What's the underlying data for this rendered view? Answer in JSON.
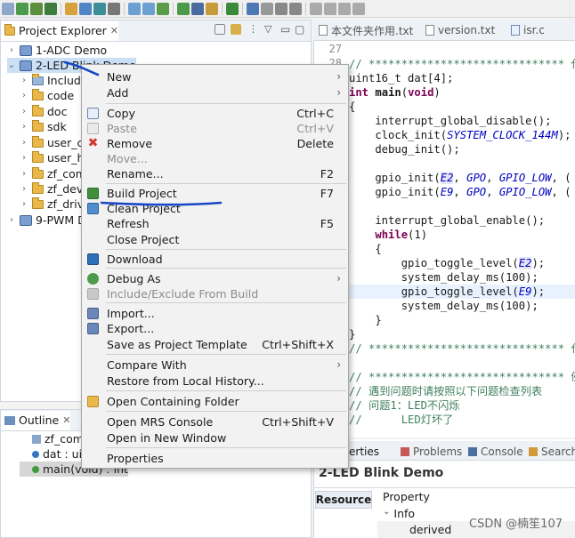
{
  "project_explorer": {
    "tab_label": "Project Explorer",
    "items": [
      {
        "label": "1-ADC Demo"
      },
      {
        "label": "2-LED Blink Demo"
      },
      {
        "label": "Include"
      },
      {
        "label": "code"
      },
      {
        "label": "doc"
      },
      {
        "label": "sdk"
      },
      {
        "label": "user_c"
      },
      {
        "label": "user_h"
      },
      {
        "label": "zf_comm"
      },
      {
        "label": "zf_devic"
      },
      {
        "label": "zf_drive"
      },
      {
        "label": "9-PWM De"
      }
    ]
  },
  "outline": {
    "tab_label": "Outline",
    "items": [
      {
        "label": "zf_comm"
      },
      {
        "label": "dat : uint"
      },
      {
        "label": "main(void) : int"
      }
    ]
  },
  "editor": {
    "tabs": [
      {
        "label": "本文件夹作用.txt"
      },
      {
        "label": "version.txt"
      },
      {
        "label": "isr.c"
      }
    ],
    "line_numbers": [
      "27",
      "28"
    ]
  },
  "bottom_panel": {
    "tabs": [
      {
        "label": "erties"
      },
      {
        "label": "Problems"
      },
      {
        "label": "Console"
      },
      {
        "label": "Search"
      }
    ],
    "title": "2-LED Blink Demo",
    "side_tab": "Resource",
    "column_header": "Property",
    "group": "Info",
    "row": "derived"
  },
  "context_menu": {
    "new": "New",
    "add": "Add",
    "copy": "Copy",
    "copy_sc": "Ctrl+C",
    "paste": "Paste",
    "paste_sc": "Ctrl+V",
    "remove": "Remove",
    "remove_sc": "Delete",
    "move": "Move...",
    "rename": "Rename...",
    "rename_sc": "F2",
    "build": "Build Project",
    "build_sc": "F7",
    "clean": "Clean Project",
    "refresh": "Refresh",
    "refresh_sc": "F5",
    "close": "Close Project",
    "download": "Download",
    "debug_as": "Debug As",
    "include_exclude": "Include/Exclude From Build",
    "import": "Import...",
    "export": "Export...",
    "save_template": "Save as Project Template",
    "save_template_sc": "Ctrl+Shift+X",
    "compare": "Compare With",
    "restore": "Restore from Local History...",
    "open_folder": "Open Containing Folder",
    "mrs_console": "Open MRS Console",
    "mrs_console_sc": "Ctrl+Shift+V",
    "new_window": "Open in New Window",
    "properties": "Properties"
  },
  "watermark": "CSDN @楠笙107",
  "colors": {
    "annotation_stroke": "#1846c6",
    "keyword": "#7f0055",
    "comment": "#3f7f5f",
    "constant": "#0000c0"
  }
}
